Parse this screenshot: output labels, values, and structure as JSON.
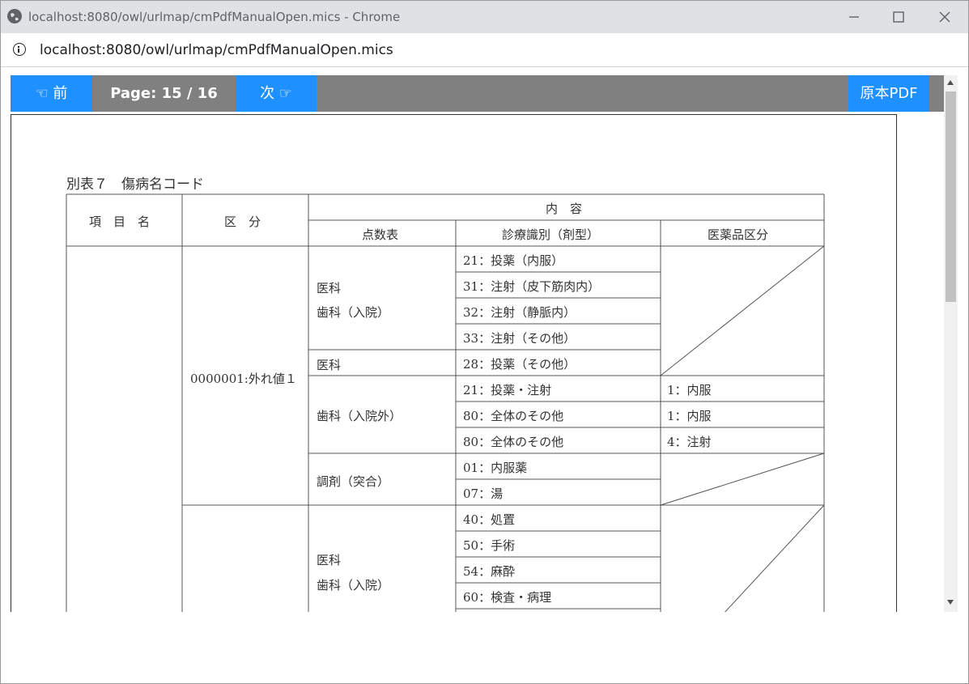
{
  "window": {
    "title": "localhost:8080/owl/urlmap/cmPdfManualOpen.mics - Chrome",
    "url": "localhost:8080/owl/urlmap/cmPdfManualOpen.mics"
  },
  "toolbar": {
    "prev_label": "☜ 前",
    "page_label": "Page: 15 / 16",
    "next_label": "次 ☞",
    "original_pdf_label": "原本PDF",
    "accent_color": "#1e90ff"
  },
  "document": {
    "table_title": "別表７　傷病名コード",
    "headers": {
      "item_name": "項　目　名",
      "category": "区　分",
      "contents": "内　容",
      "score_table": "点数表",
      "diagnosis_type": "診療識別（剤型）",
      "drug_category": "医薬品区分"
    },
    "group1_label": "0000001:外れ値１",
    "score_table_cells": [
      "医科",
      "歯科（入院）",
      "医科",
      "歯科（入院外）",
      "調剤（突合）",
      "医科",
      "歯科（入院）"
    ],
    "diagnosis_rows": [
      "21：投薬（内服）",
      "31：注射（皮下筋肉内）",
      "32：注射（静脈内）",
      "33：注射（その他）",
      "28：投薬（その他）",
      "21：投薬・注射",
      "80：全体のその他",
      "80：全体のその他",
      "01：内服薬",
      "07：湯",
      "40：処置",
      "50：手術",
      "54：麻酔",
      "60：検査・病理"
    ],
    "drug_rows": [
      "1：内服",
      "1：内服",
      "4：注射"
    ]
  }
}
